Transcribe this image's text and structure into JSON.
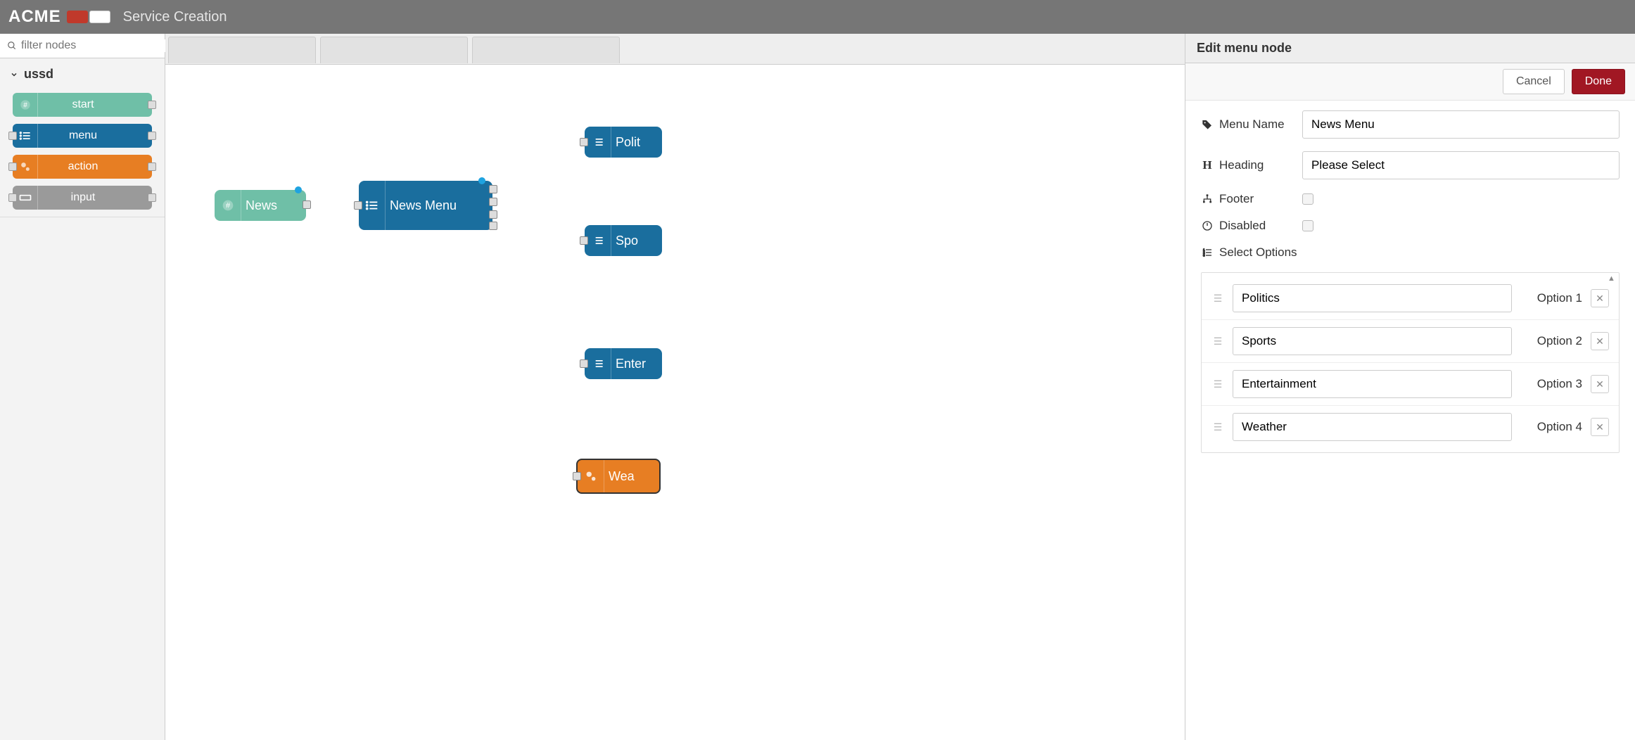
{
  "header": {
    "brand": "ACME",
    "title": "Service Creation"
  },
  "sidebar": {
    "filter_placeholder": "filter nodes",
    "category": "ussd",
    "palette": [
      {
        "key": "start",
        "label": "start"
      },
      {
        "key": "menu",
        "label": "menu"
      },
      {
        "key": "action",
        "label": "action"
      },
      {
        "key": "input",
        "label": "input"
      }
    ]
  },
  "canvas": {
    "nodes": {
      "start": {
        "label": "News"
      },
      "menu": {
        "label": "News Menu"
      },
      "m1": {
        "label": "Polit"
      },
      "m2": {
        "label": "Spo"
      },
      "m3": {
        "label": "Enter"
      },
      "act": {
        "label": "Wea"
      }
    }
  },
  "panel": {
    "title": "Edit menu node",
    "cancel": "Cancel",
    "done": "Done",
    "fields": {
      "name_label": "Menu Name",
      "name_value": "News Menu",
      "heading_label": "Heading",
      "heading_value": "Please Select",
      "footer_label": "Footer",
      "disabled_label": "Disabled",
      "select_label": "Select Options"
    },
    "options": [
      {
        "value": "Politics",
        "num": "Option 1"
      },
      {
        "value": "Sports",
        "num": "Option 2"
      },
      {
        "value": "Entertainment",
        "num": "Option 3"
      },
      {
        "value": "Weather",
        "num": "Option 4"
      }
    ]
  }
}
